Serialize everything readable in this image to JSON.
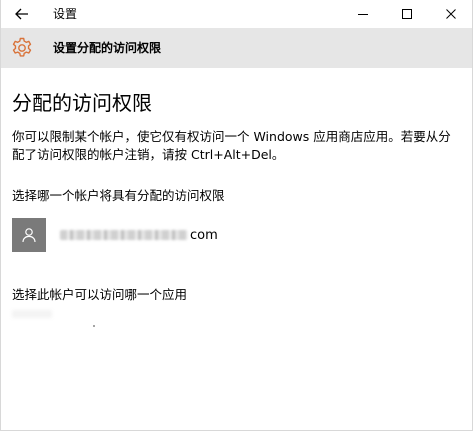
{
  "window": {
    "title": "设置"
  },
  "header": {
    "title": "设置分配的访问权限"
  },
  "main": {
    "page_title": "分配的访问权限",
    "description": "你可以限制某个帐户，使它仅有权访问一个 Windows 应用商店应用。若要从分配了访问权限的帐户注销，请按 Ctrl+Alt+Del。",
    "choose_account_label": "选择哪一个帐户将具有分配的访问权限",
    "account": {
      "email_visible_suffix": "com"
    },
    "choose_app_label": "选择此帐户可以访问哪一个应用"
  },
  "icons": {
    "back": "back-arrow-icon",
    "minimize": "minimize-icon",
    "maximize": "maximize-icon",
    "close": "close-icon",
    "settings": "gear-icon",
    "user": "user-icon"
  },
  "colors": {
    "accent": "#d9733a",
    "header_band": "#e6e6e6",
    "avatar_bg": "#7a7a7a"
  }
}
